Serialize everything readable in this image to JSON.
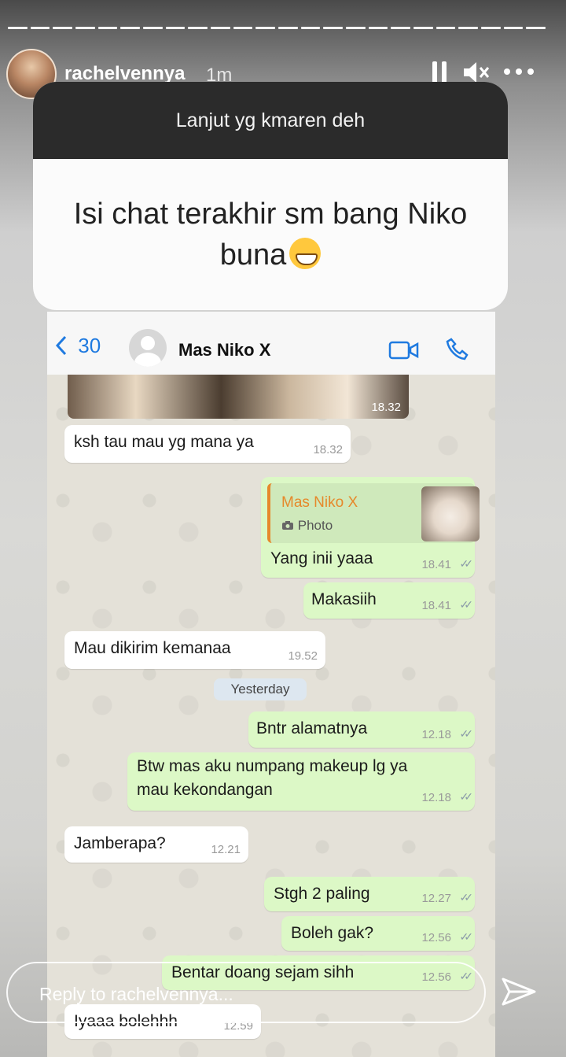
{
  "story": {
    "username": "rachelvennya",
    "time_ago": "1m"
  },
  "question_sticker": {
    "prompt": "Lanjut yg kmaren deh",
    "answer": "Isi chat terakhir sm bang Niko buna"
  },
  "chat": {
    "back_count": "30",
    "contact_name": "Mas Niko X",
    "photo_time": "18.32",
    "messages": [
      {
        "text": "ksh tau mau yg mana ya",
        "time": "18.32"
      },
      {
        "reply_name": "Mas Niko X",
        "reply_label": "Photo",
        "text": "Yang inii yaaa",
        "time": "18.41"
      },
      {
        "text": "Makasiih",
        "time": "18.41"
      },
      {
        "text": "Mau dikirim kemanaa",
        "time": "19.52"
      },
      {
        "text": "Bntr alamatnya",
        "time": "12.18"
      },
      {
        "text_line1": "Btw mas aku numpang makeup lg ya",
        "text_line2": "mau kekondangan",
        "time": "12.18"
      },
      {
        "text": "Jamberapa?",
        "time": "12.21"
      },
      {
        "text": "Stgh 2 paling",
        "time": "12.27"
      },
      {
        "text": "Boleh gak?",
        "time": "12.56"
      },
      {
        "text": "Bentar doang sejam sihh",
        "time": "12.56"
      },
      {
        "text": "Iyaaa bolehhh",
        "time": "12.59"
      }
    ],
    "date_separator": "Yesterday"
  },
  "reply": {
    "placeholder": "Reply to rachelvennya..."
  },
  "colors": {
    "outgoing_bubble": "#dcf8c6",
    "incoming_bubble": "#ffffff",
    "accent_blue": "#1f7ae0",
    "reply_orange": "#e6892b"
  }
}
